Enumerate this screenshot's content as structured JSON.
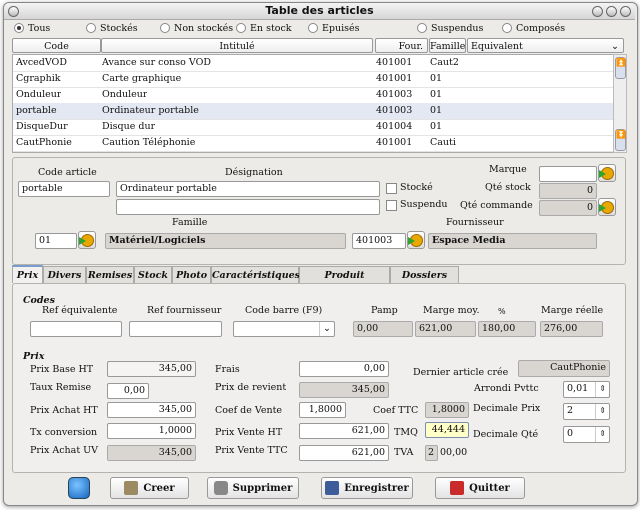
{
  "window": {
    "title": "Table des articles"
  },
  "filters": [
    {
      "label": "Tous",
      "selected": true
    },
    {
      "label": "Stockés"
    },
    {
      "label": "Non stockés"
    },
    {
      "label": "En stock"
    },
    {
      "label": "Epuisés"
    },
    {
      "label": "Suspendus"
    },
    {
      "label": "Composés"
    }
  ],
  "table": {
    "columns": [
      "Code",
      "Intitulé",
      "Four.",
      "Famille",
      "Equivalent"
    ],
    "rows": [
      [
        "AvcedVOD",
        "Avance sur conso VOD",
        "401001",
        "Caut2",
        ""
      ],
      [
        "Cgraphik",
        "Carte graphique",
        "401001",
        "01",
        ""
      ],
      [
        "Onduleur",
        "Onduleur",
        "401003",
        "01",
        ""
      ],
      [
        "portable",
        "Ordinateur portable",
        "401003",
        "01",
        ""
      ],
      [
        "DisqueDur",
        "Disque dur",
        "401004",
        "01",
        ""
      ],
      [
        "CautPhonie",
        "Caution Téléphonie",
        "401001",
        "Cauti",
        ""
      ]
    ],
    "selected_row": 3
  },
  "article": {
    "code_label": "Code article",
    "code": "portable",
    "designation_label": "Désignation",
    "designation": "Ordinateur portable",
    "designation2": "",
    "stocke_label": "Stocké",
    "suspendu_label": "Suspendu",
    "marque_label": "Marque",
    "marque": "",
    "qte_stock_label": "Qté stock",
    "qte_stock": "0",
    "qte_commande_label": "Qté commande",
    "qte_commande": "0",
    "famille_label": "Famille",
    "famille_code": "01",
    "famille_name": "Matériel/Logiciels",
    "fournisseur_label": "Fournisseur",
    "fournisseur_code": "401003",
    "fournisseur_name": "Espace Media"
  },
  "tabs": [
    "Prix",
    "Divers",
    "Remises",
    "Stock",
    "Photo",
    "Caractéristiques",
    "Produit composé",
    "Dossiers liés"
  ],
  "codes": {
    "title": "Codes",
    "ref_equiv_label": "Ref équivalente",
    "ref_four_label": "Ref fournisseur",
    "code_barre_label": "Code barre (F9)",
    "pamp_label": "Pamp",
    "marge_moy_label": "Marge moy.",
    "pct_label": "%",
    "marge_reelle_label": "Marge réelle",
    "pamp": "0,00",
    "marge_moy": "621,00",
    "pct": "180,00",
    "marge_reelle": "276,00"
  },
  "prix": {
    "title": "Prix",
    "prix_base_ht_label": "Prix Base HT",
    "prix_base_ht": "345,00",
    "taux_remise_label": "Taux Remise",
    "taux_remise": "0,00",
    "prix_achat_ht_label": "Prix Achat HT",
    "prix_achat_ht": "345,00",
    "tx_conversion_label": "Tx conversion",
    "tx_conversion": "1,0000",
    "prix_achat_uv_label": "Prix Achat UV",
    "prix_achat_uv": "345,00",
    "frais_label": "Frais",
    "frais": "0,00",
    "prix_revient_label": "Prix de revient",
    "prix_revient": "345,00",
    "coef_vente_label": "Coef de Vente",
    "coef_vente": "1,8000",
    "coef_ttc_label": "Coef TTC",
    "coef_ttc": "1,8000",
    "prix_vente_ht_label": "Prix Vente HT",
    "prix_vente_ht": "621,00",
    "tmq_label": "TMQ",
    "tmq": "44,444",
    "prix_vente_ttc_label": "Prix Vente TTC",
    "prix_vente_ttc": "621,00",
    "tva_label": "TVA",
    "tva_code": "2",
    "tva_rate": "00,00",
    "dernier_label": "Dernier article crée",
    "dernier": "CautPhonie",
    "arrondi_label": "Arrondi Pvttc",
    "arrondi": "0,01",
    "dec_prix_label": "Decimale Prix",
    "dec_prix": "2",
    "dec_qte_label": "Decimale Qté",
    "dec_qte": "0"
  },
  "buttons": {
    "creer": "Creer",
    "supprimer": "Supprimer",
    "enregistrer": "Enregistrer",
    "quitter": "Quitter"
  }
}
